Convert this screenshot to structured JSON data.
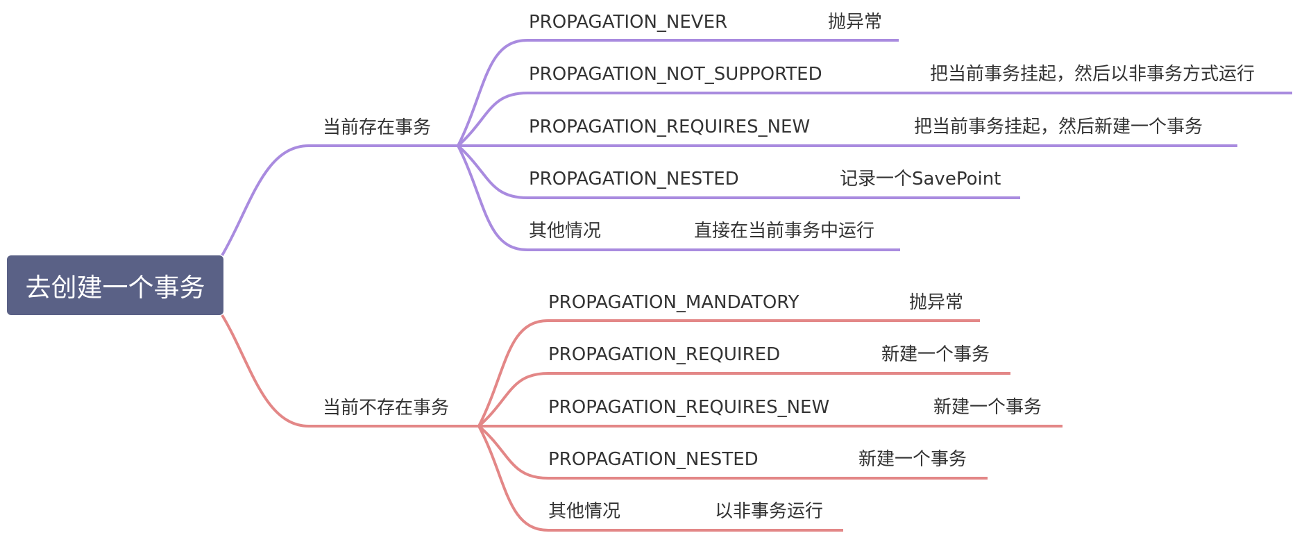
{
  "root": {
    "label": "去创建一个事务"
  },
  "branches": [
    {
      "label": "当前存在事务",
      "color": "#a98bdf",
      "children": [
        {
          "key": "PROPAGATION_NEVER",
          "value": "抛异常"
        },
        {
          "key": "PROPAGATION_NOT_SUPPORTED",
          "value": "把当前事务挂起，然后以非事务方式运行"
        },
        {
          "key": "PROPAGATION_REQUIRES_NEW",
          "value": "把当前事务挂起，然后新建一个事务"
        },
        {
          "key": "PROPAGATION_NESTED",
          "value": "记录一个SavePoint"
        },
        {
          "key": "其他情况",
          "value": "直接在当前事务中运行"
        }
      ]
    },
    {
      "label": "当前不存在事务",
      "color": "#e38787",
      "children": [
        {
          "key": "PROPAGATION_MANDATORY",
          "value": "抛异常"
        },
        {
          "key": "PROPAGATION_REQUIRED",
          "value": "新建一个事务"
        },
        {
          "key": "PROPAGATION_REQUIRES_NEW",
          "value": "新建一个事务"
        },
        {
          "key": "PROPAGATION_NESTED",
          "value": "新建一个事务"
        },
        {
          "key": "其他情况",
          "value": "以非事务运行"
        }
      ]
    }
  ]
}
